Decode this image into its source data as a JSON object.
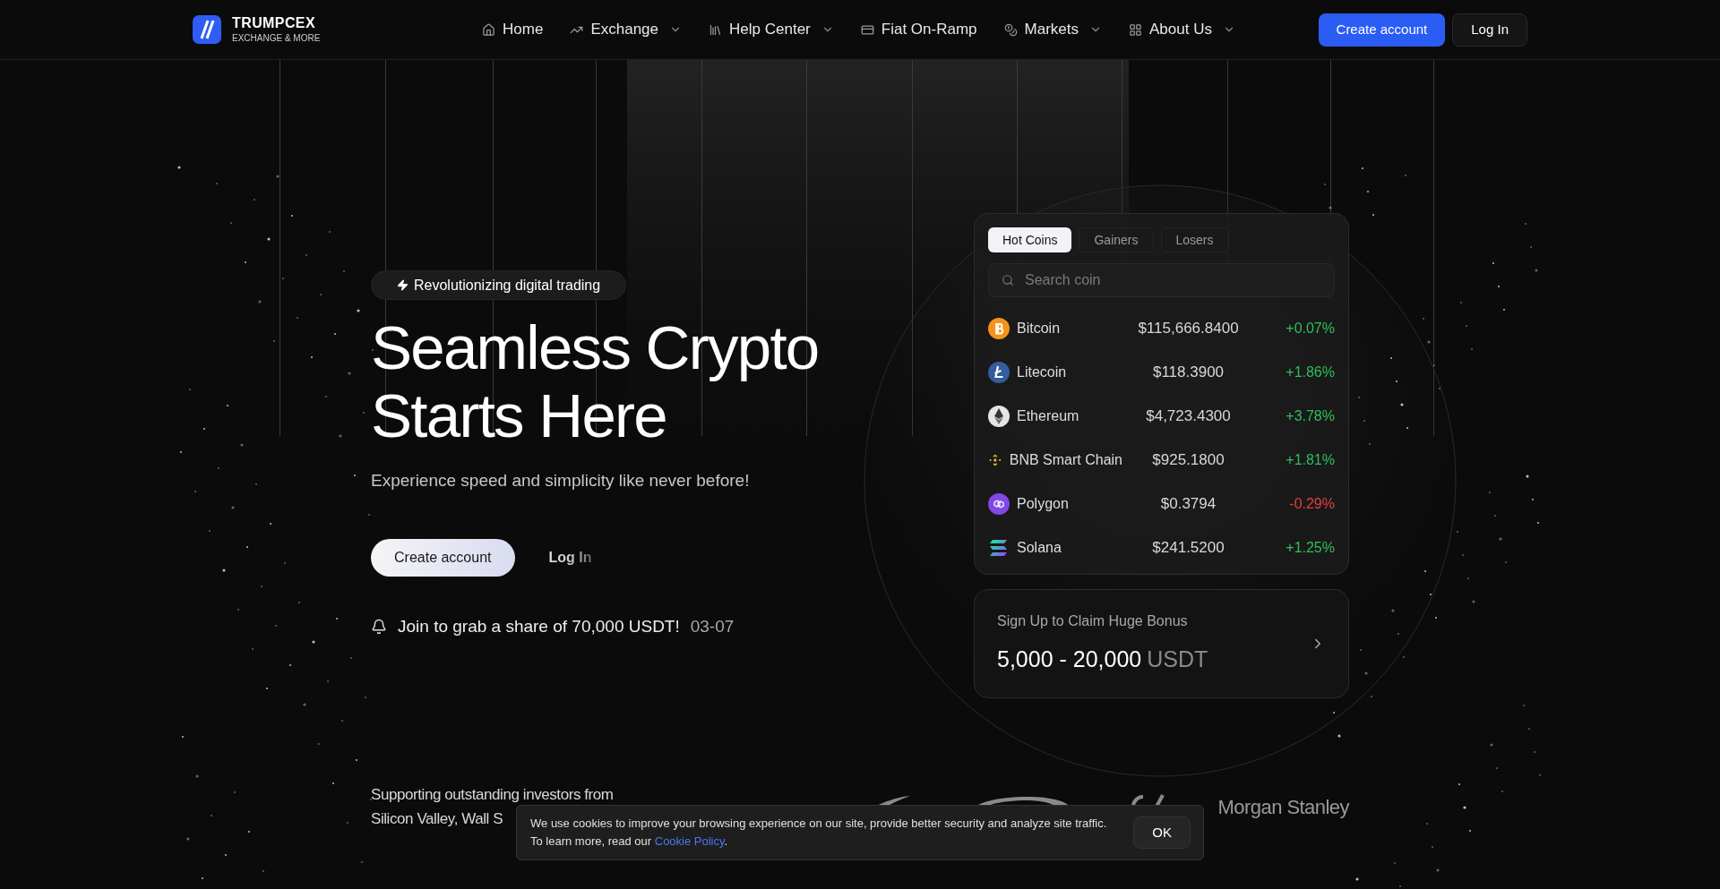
{
  "brand": {
    "name": "TRUMPCEX",
    "tagline": "EXCHANGE & MORE"
  },
  "nav": [
    {
      "label": "Home",
      "dropdown": false
    },
    {
      "label": "Exchange",
      "dropdown": true
    },
    {
      "label": "Help Center",
      "dropdown": true
    },
    {
      "label": "Fiat On-Ramp",
      "dropdown": false
    },
    {
      "label": "Markets",
      "dropdown": true
    },
    {
      "label": "About Us",
      "dropdown": true
    }
  ],
  "header_buttons": [
    {
      "label": "Create account",
      "kind": "primary"
    },
    {
      "label": "Log In",
      "kind": "secondary"
    }
  ],
  "hero": {
    "badge": "Revolutionizing digital trading",
    "title_lines": [
      "Seamless Crypto",
      "Starts Here"
    ],
    "subtitle": "Experience speed and simplicity like never before!",
    "buttons": [
      {
        "label": "Create account",
        "kind": "primary"
      },
      {
        "label": "Log In",
        "kind": "ghost"
      }
    ],
    "notice": {
      "text": "Join to grab a share of 70,000 USDT!",
      "date": "03-07"
    }
  },
  "market": {
    "tabs": [
      {
        "label": "Hot Coins",
        "selected": true
      },
      {
        "label": "Gainers",
        "selected": false
      },
      {
        "label": "Losers",
        "selected": false
      }
    ],
    "search": {
      "placeholder": "Search coin"
    },
    "coins": [
      {
        "name": "Bitcoin",
        "price": "$115,666.8400",
        "change": "+0.07%",
        "color": "#2fbf5d"
      },
      {
        "name": "Litecoin",
        "price": "$118.3900",
        "change": "+1.86%",
        "color": "#2fbf5d"
      },
      {
        "name": "Ethereum",
        "price": "$4,723.4300",
        "change": "+3.78%",
        "color": "#2fbf5d"
      },
      {
        "name": "BNB Smart Chain",
        "price": "$925.1800",
        "change": "+1.81%",
        "color": "#2fbf5d"
      },
      {
        "name": "Polygon",
        "price": "$0.3794",
        "change": "-0.29%",
        "color": "#e0403f"
      },
      {
        "name": "Solana",
        "price": "$241.5200",
        "change": "+1.25%",
        "color": "#2fbf5d"
      }
    ]
  },
  "bonus": {
    "title": "Sign Up to Claim Huge Bonus",
    "amount": "5,000 - 20,000",
    "unit": "USDT"
  },
  "investors": {
    "lines": [
      "Supporting outstanding investors from",
      "Silicon Valley, Wall S"
    ],
    "partner_name": "Morgan Stanley"
  },
  "cookie": {
    "text": "We use cookies to improve your browsing experience on our site, provide better security and analyze site traffic. To learn more, read our",
    "link": "Cookie Policy",
    "suffix": ".",
    "button": "OK"
  }
}
